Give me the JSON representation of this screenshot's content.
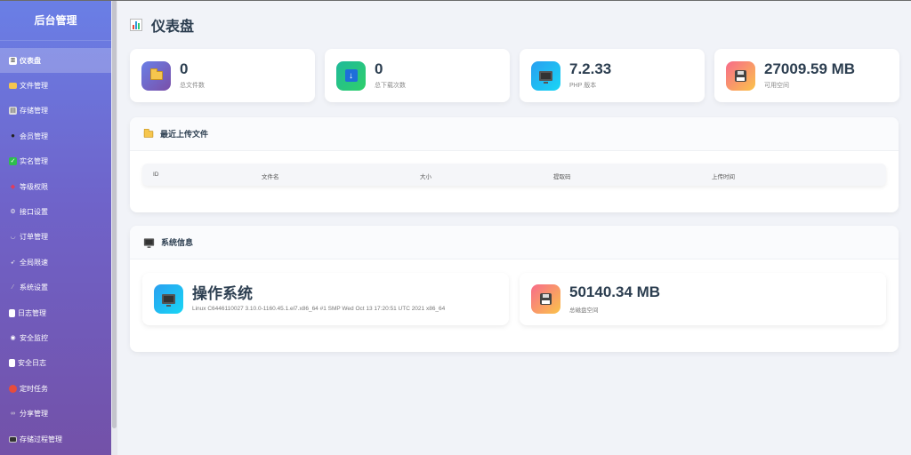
{
  "sidebar": {
    "title": "后台管理",
    "items": [
      {
        "label": "仪表盘",
        "icon": "chart-icon",
        "active": true
      },
      {
        "label": "文件管理",
        "icon": "folder-icon"
      },
      {
        "label": "存储管理",
        "icon": "storage-icon"
      },
      {
        "label": "会员管理",
        "icon": "users-icon"
      },
      {
        "label": "实名管理",
        "icon": "check-icon"
      },
      {
        "label": "等级权限",
        "icon": "shield-icon"
      },
      {
        "label": "接口设置",
        "icon": "gear-icon"
      },
      {
        "label": "订单管理",
        "icon": "basket-icon"
      },
      {
        "label": "全局限速",
        "icon": "rocket-icon"
      },
      {
        "label": "系统设置",
        "icon": "wrench-icon"
      },
      {
        "label": "日志管理",
        "icon": "document-icon"
      },
      {
        "label": "安全监控",
        "icon": "eye-icon"
      },
      {
        "label": "安全日志",
        "icon": "log-icon"
      },
      {
        "label": "定时任务",
        "icon": "clock-icon"
      },
      {
        "label": "分享管理",
        "icon": "link-icon"
      },
      {
        "label": "存储过程管理",
        "icon": "monitor-icon"
      }
    ]
  },
  "header": {
    "title": "仪表盘"
  },
  "stats": [
    {
      "value": "0",
      "label": "总文件数",
      "icon": "folder-icon",
      "color": "#6a7fe6"
    },
    {
      "value": "0",
      "label": "总下载次数",
      "icon": "download-icon",
      "color": "#1fb99a"
    },
    {
      "value": "7.2.33",
      "label": "PHP 版本",
      "icon": "monitor-icon",
      "color": "#2a9ff0"
    },
    {
      "value": "27009.59 MB",
      "label": "可用空间",
      "icon": "floppy-disk-icon",
      "color": "#f76b8a"
    }
  ],
  "recent": {
    "title": "最近上传文件",
    "columns": [
      "ID",
      "文件名",
      "大小",
      "提取码",
      "上传时间"
    ]
  },
  "system": {
    "title": "系统信息",
    "os": {
      "title": "操作系统",
      "detail": "Linux C6446110027 3.10.0-1160.45.1.el7.x86_64 #1 SMP Wed Oct 13 17:20:51 UTC 2021 x86_64"
    },
    "disk": {
      "value": "50140.34 MB",
      "label": "总磁盘空间"
    }
  }
}
